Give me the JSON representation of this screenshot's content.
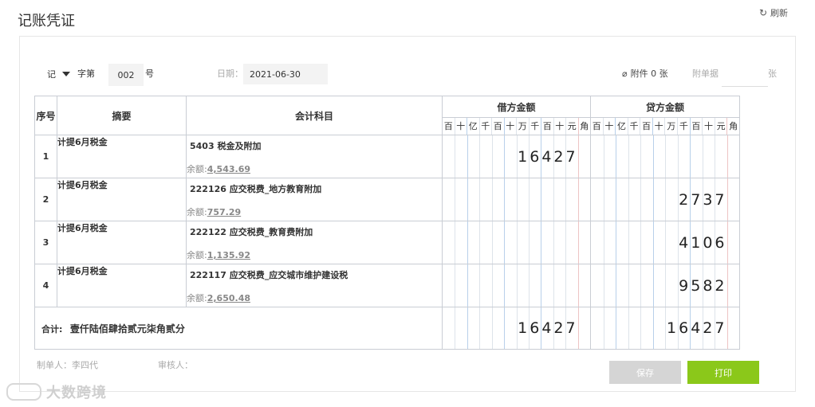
{
  "page": {
    "title": "记账凭证",
    "refresh_label": "刷新"
  },
  "header": {
    "voucher_word": "记",
    "zi_di": "字第",
    "number": "002",
    "hao": "号",
    "date_label": "日期：",
    "date_value": "2021-06-30",
    "attachments_label": "附件 0 张",
    "bill_label": "附单据",
    "bill_value": "",
    "zhang": "张"
  },
  "table": {
    "headers": {
      "seq": "序号",
      "summary": "摘要",
      "account": "会计科目",
      "debit": "借方金额",
      "credit": "贷方金额"
    },
    "digit_units": [
      "百",
      "十",
      "亿",
      "千",
      "百",
      "十",
      "万",
      "千",
      "百",
      "十",
      "元",
      "角"
    ],
    "rows": [
      {
        "seq": "1",
        "summary": "计提6月税金",
        "account": "5403 税金及附加",
        "balance_label": "余额:",
        "balance": "4,543.69",
        "debit": "16427",
        "credit": ""
      },
      {
        "seq": "2",
        "summary": "计提6月税金",
        "account": "222126 应交税费_地方教育附加",
        "balance_label": "余额:",
        "balance": "757.29",
        "debit": "",
        "credit": "2737"
      },
      {
        "seq": "3",
        "summary": "计提6月税金",
        "account": "222122 应交税费_教育费附加",
        "balance_label": "余额:",
        "balance": "1,135.92",
        "debit": "",
        "credit": "4106"
      },
      {
        "seq": "4",
        "summary": "计提6月税金",
        "account": "222117 应交税费_应交城市维护建设税",
        "balance_label": "余额:",
        "balance": "2,650.48",
        "debit": "",
        "credit": "9582"
      }
    ],
    "total": {
      "label": "合计:",
      "words": "壹仟陆佰肆拾贰元柒角贰分",
      "debit": "16427",
      "credit": "16427"
    }
  },
  "footer": {
    "maker": "制单人：李四代",
    "reviewer": "审核人：",
    "save_label": "保存",
    "print_label": "打印"
  },
  "watermark": {
    "text": "大数跨境"
  },
  "colors": {
    "print_button": "#8bc81a",
    "save_button": "#d5d5d5",
    "grid_blue": "#b8d0ea",
    "grid_red": "#eec4c4"
  }
}
